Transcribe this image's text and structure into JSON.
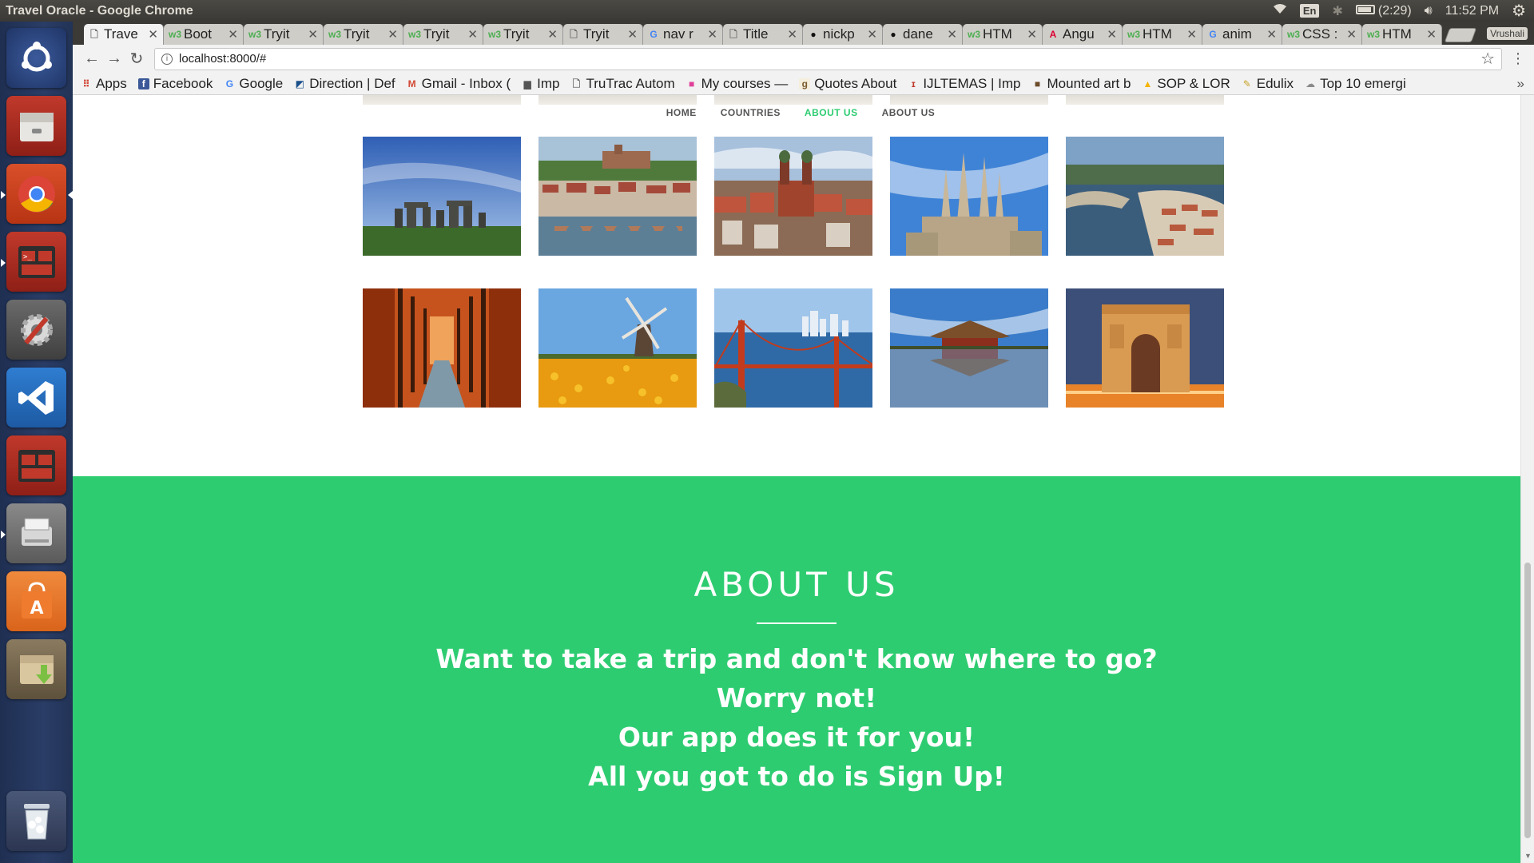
{
  "window": {
    "title": "Travel Oracle - Google Chrome"
  },
  "system_tray": {
    "keyboard": "En",
    "battery": "(2:29)",
    "clock": "11:52 PM"
  },
  "tabs": [
    {
      "label": "Trave",
      "favicon": "page-icon",
      "active": true
    },
    {
      "label": "Boot",
      "favicon": "w3-icon"
    },
    {
      "label": "Tryit",
      "favicon": "w3-icon"
    },
    {
      "label": "Tryit",
      "favicon": "w3-icon"
    },
    {
      "label": "Tryit",
      "favicon": "w3-icon"
    },
    {
      "label": "Tryit",
      "favicon": "w3-icon"
    },
    {
      "label": "Tryit",
      "favicon": "page-icon"
    },
    {
      "label": "nav r",
      "favicon": "google-icon"
    },
    {
      "label": "Title",
      "favicon": "page-icon"
    },
    {
      "label": "nickp",
      "favicon": "github-icon"
    },
    {
      "label": "dane",
      "favicon": "github-icon"
    },
    {
      "label": "HTM",
      "favicon": "w3-icon"
    },
    {
      "label": "Angu",
      "favicon": "angular-icon"
    },
    {
      "label": "HTM",
      "favicon": "w3-icon"
    },
    {
      "label": "anim",
      "favicon": "google-icon"
    },
    {
      "label": "CSS :",
      "favicon": "w3-icon"
    },
    {
      "label": "HTM",
      "favicon": "w3-icon"
    }
  ],
  "profile_name": "Vrushali",
  "address_bar": {
    "url": "localhost:8000/#"
  },
  "bookmarks": [
    {
      "label": "Apps",
      "icon": "apps-grid-icon"
    },
    {
      "label": "Facebook",
      "icon": "facebook-icon"
    },
    {
      "label": "Google",
      "icon": "google-icon"
    },
    {
      "label": "Direction | Def",
      "icon": "direction-icon"
    },
    {
      "label": "Gmail - Inbox (",
      "icon": "gmail-icon"
    },
    {
      "label": "Imp",
      "icon": "folder-icon"
    },
    {
      "label": "TruTrac Autom",
      "icon": "page-icon"
    },
    {
      "label": "My courses —",
      "icon": "courses-icon"
    },
    {
      "label": "Quotes About",
      "icon": "goodreads-icon"
    },
    {
      "label": "IJLTEMAS | Imp",
      "icon": "ijltemas-icon"
    },
    {
      "label": "Mounted art b",
      "icon": "art-icon"
    },
    {
      "label": "SOP & LOR",
      "icon": "drive-icon"
    },
    {
      "label": "Edulix",
      "icon": "edulix-icon"
    },
    {
      "label": "Top 10 emergi",
      "icon": "cloud-icon"
    }
  ],
  "bookmarks_more": "»",
  "site_nav": {
    "items": [
      "HOME",
      "COUNTRIES",
      "ABOUT US",
      "ABOUT US"
    ],
    "active_index": 2
  },
  "gallery": [
    {
      "name": "stonehenge-image",
      "alt": "Stonehenge"
    },
    {
      "name": "heidelberg-image",
      "alt": "Heidelberg"
    },
    {
      "name": "munich-image",
      "alt": "Munich"
    },
    {
      "name": "sagrada-familia-image",
      "alt": "Sagrada Familia"
    },
    {
      "name": "porto-image",
      "alt": "Porto"
    },
    {
      "name": "fushimi-inari-image",
      "alt": "Fushimi Inari"
    },
    {
      "name": "windmill-image",
      "alt": "Windmill tulip field"
    },
    {
      "name": "golden-gate-image",
      "alt": "Golden Gate Bridge"
    },
    {
      "name": "forbidden-city-image",
      "alt": "Forbidden City"
    },
    {
      "name": "arc-de-triomphe-image",
      "alt": "Arc de Triomphe"
    }
  ],
  "about": {
    "heading": "ABOUT US",
    "lines": [
      "Want to take a trip and don't know where to go?",
      "Worry not!",
      "Our app does it for you!",
      "All you got to do is Sign Up!"
    ]
  },
  "colors": {
    "accent": "#2ecc71",
    "nav_text": "#555555"
  }
}
